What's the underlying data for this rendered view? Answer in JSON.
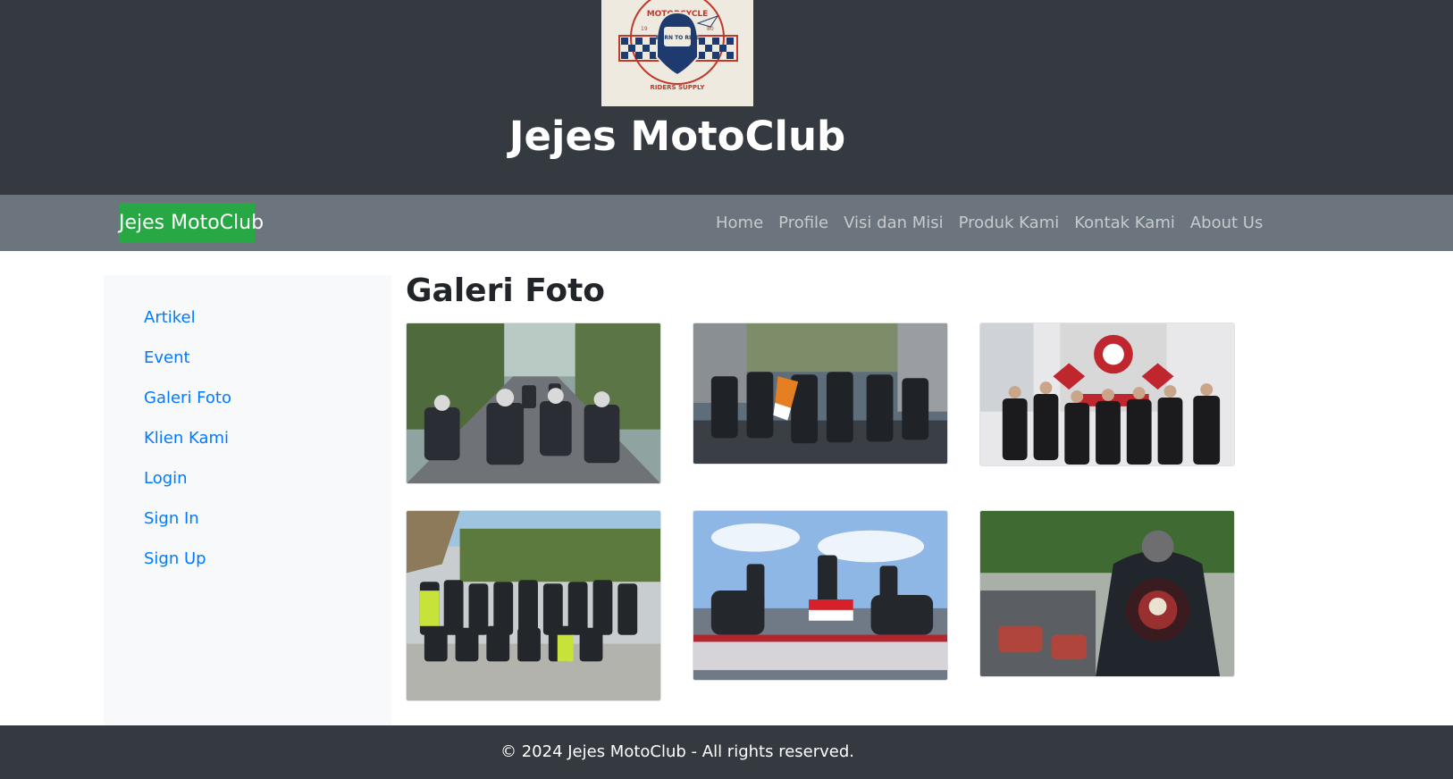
{
  "header": {
    "site_title": "Jejes MotoClub",
    "logo": {
      "icon": "motorcycle-club-badge-logo",
      "text_top": "MOTORCYCLE",
      "text_center": "BORN TO RIDE",
      "text_bottom": "RIDERS SUPPLY",
      "year_left": "19",
      "year_right": "80"
    }
  },
  "navbar": {
    "brand": "Jejes MotoClub",
    "links": [
      "Home",
      "Profile",
      "Visi dan Misi",
      "Produk Kami",
      "Kontak Kami",
      "About Us"
    ]
  },
  "sidebar": {
    "links": [
      "Artikel",
      "Event",
      "Galeri Foto",
      "Klien Kami",
      "Login",
      "Sign In",
      "Sign Up"
    ]
  },
  "main": {
    "title": "Galeri Foto",
    "photos": [
      {
        "icon": "photo-motorcycle-convoy"
      },
      {
        "icon": "photo-riders-with-flag"
      },
      {
        "icon": "photo-bikers-club-group"
      },
      {
        "icon": "photo-community-group"
      },
      {
        "icon": "photo-vixion-semeton-banner"
      },
      {
        "icon": "photo-biker-vest-back"
      }
    ]
  },
  "footer": {
    "text": "© 2024 Jejes MotoClub - All rights reserved."
  },
  "colors": {
    "header_bg": "#343a40",
    "navbar_bg": "#6c757d",
    "brand_bg": "#28a745",
    "link": "#007bff",
    "sidebar_bg": "#f8f9fa"
  }
}
